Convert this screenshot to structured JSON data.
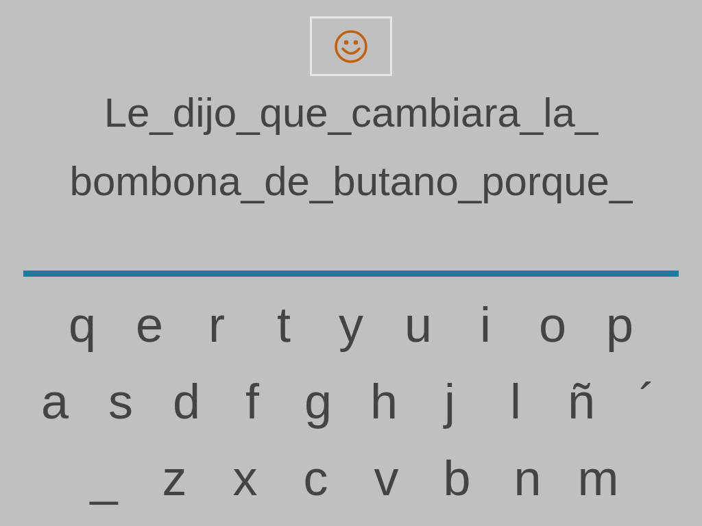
{
  "prompt_lines": [
    "Le_dijo_que_cambiara_la_",
    "bombona_de_butano_porque_"
  ],
  "keyboard_rows": [
    [
      "q",
      "e",
      "r",
      "t",
      "y",
      "u",
      "i",
      "o",
      "p"
    ],
    [
      "a",
      "s",
      "d",
      "f",
      "g",
      "h",
      "j",
      "l",
      "ñ",
      "´"
    ],
    [
      "_",
      "z",
      "x",
      "c",
      "v",
      "b",
      "n",
      "m"
    ]
  ]
}
